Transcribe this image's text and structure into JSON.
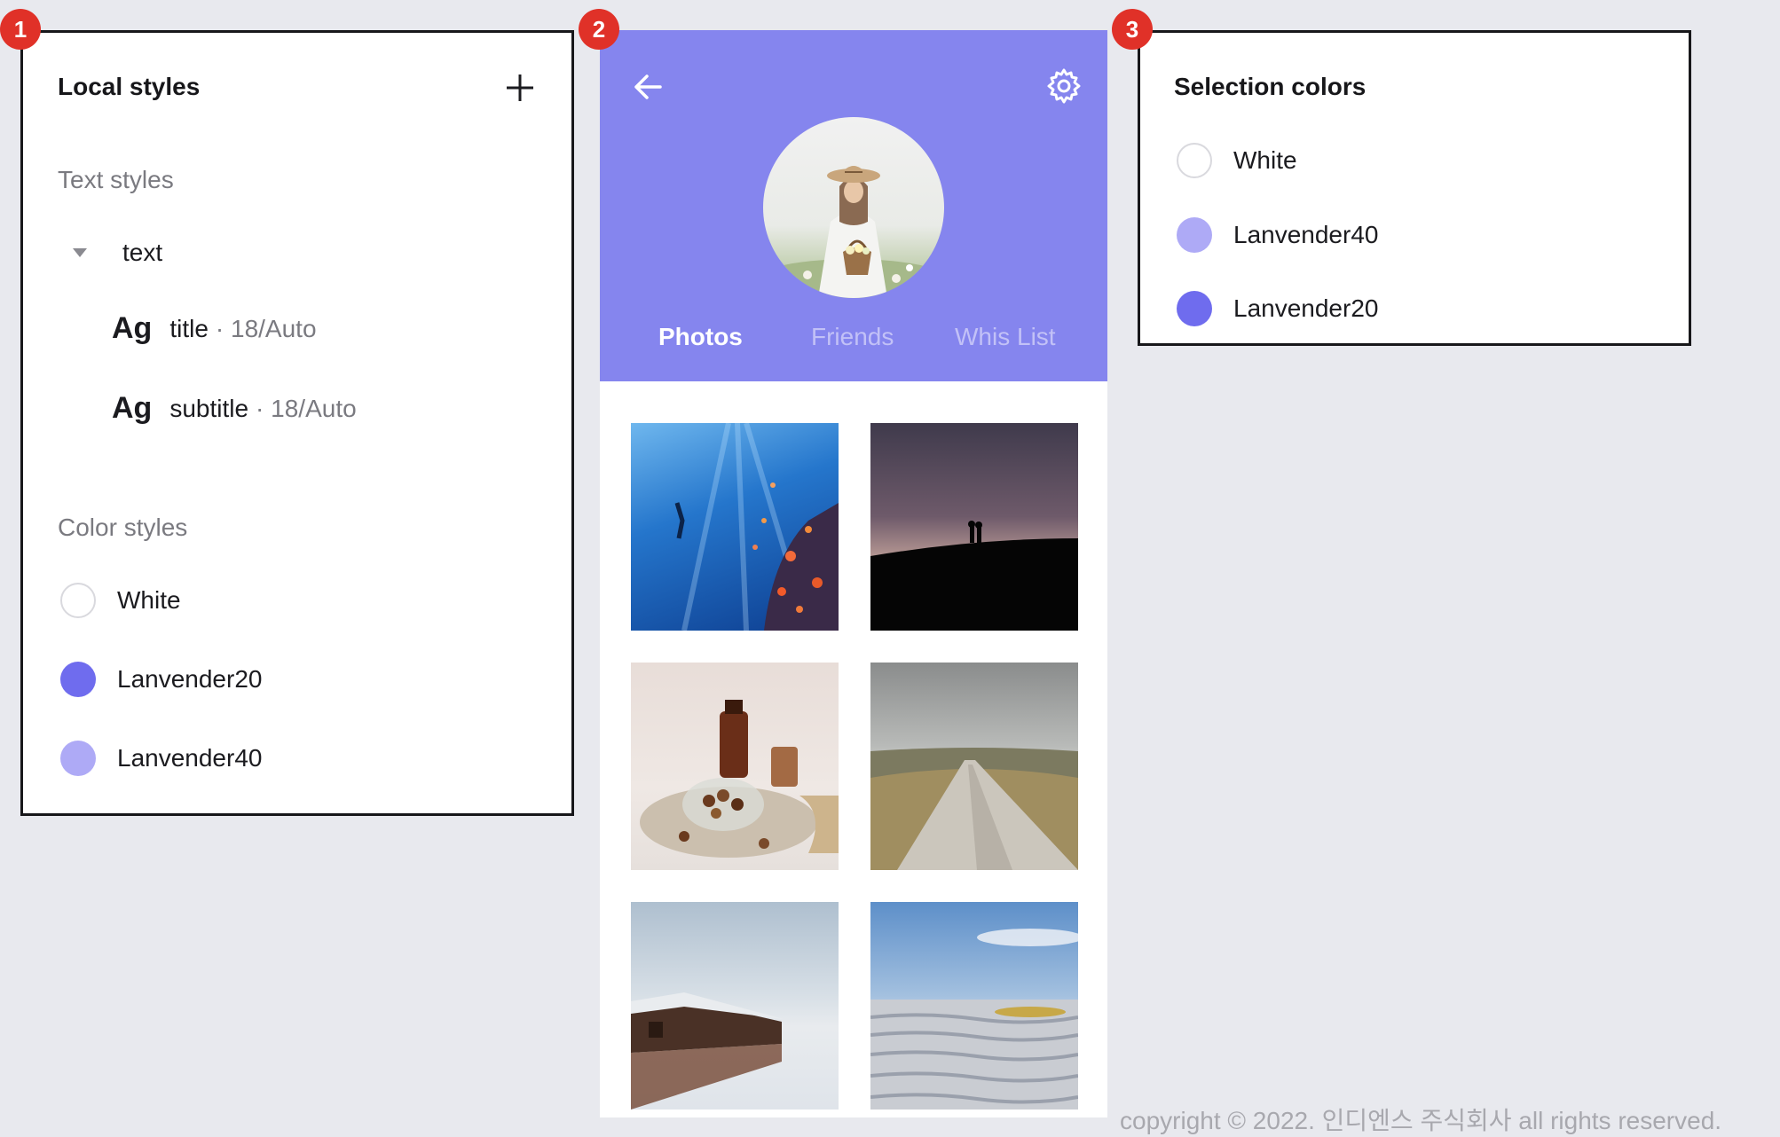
{
  "badges": [
    "1",
    "2",
    "3"
  ],
  "local_styles": {
    "title": "Local styles",
    "add_icon": "plus-icon",
    "text_styles_label": "Text styles",
    "group_label": "text",
    "text_styles": [
      {
        "sample": "Ag",
        "name": "title",
        "meta": "· 18/Auto"
      },
      {
        "sample": "Ag",
        "name": "subtitle",
        "meta": "· 18/Auto"
      }
    ],
    "color_styles_label": "Color styles",
    "colors": [
      {
        "name": "White",
        "hex": "#ffffff"
      },
      {
        "name": "Lanvender20",
        "hex": "#6f6cee"
      },
      {
        "name": "Lanvender40",
        "hex": "#aeaaf6"
      }
    ]
  },
  "profile": {
    "header_color": "#8585ee",
    "back_icon": "arrow-left-icon",
    "settings_icon": "gear-icon",
    "tabs": [
      {
        "label": "Photos",
        "active": true
      },
      {
        "label": "Friends",
        "active": false
      },
      {
        "label": "Whis List",
        "active": false
      }
    ]
  },
  "selection_colors": {
    "title": "Selection colors",
    "colors": [
      {
        "name": "White",
        "hex": "#ffffff"
      },
      {
        "name": "Lanvender40",
        "hex": "#aeaaf6"
      },
      {
        "name": "Lanvender20",
        "hex": "#6f6cee"
      }
    ]
  },
  "footer": {
    "copyright": "copyright © 2022. 인디엔스 주식회사 all rights reserved."
  }
}
